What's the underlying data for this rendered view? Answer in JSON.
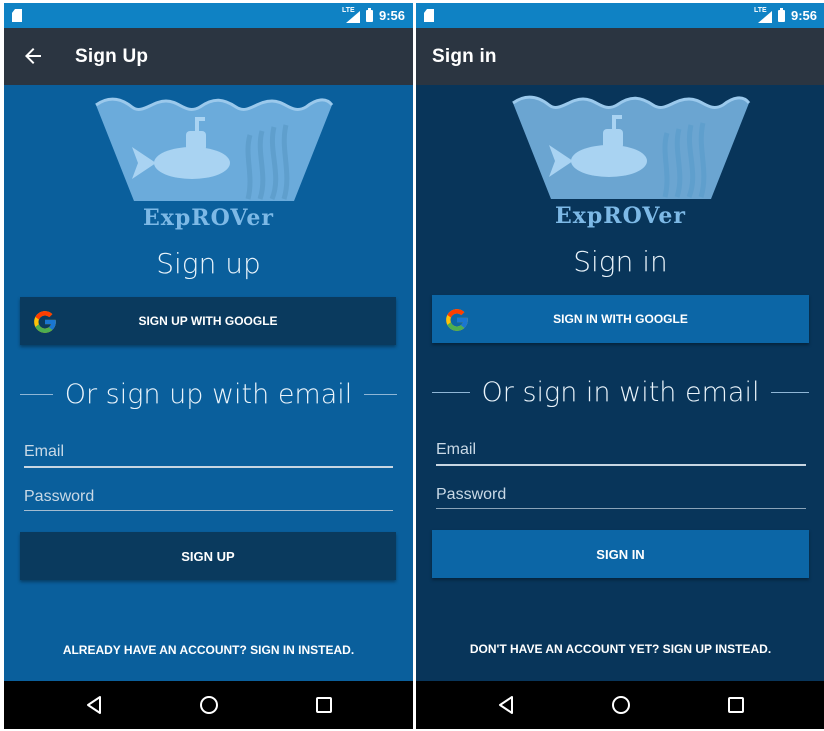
{
  "status_bar": {
    "time": "9:56",
    "network": "LTE"
  },
  "signup": {
    "toolbar_title": "Sign Up",
    "logo_text": "ExpROVer",
    "heading": "Sign up",
    "google_button": "SIGN UP WITH GOOGLE",
    "divider_text": "Or sign up with email",
    "email_placeholder": "Email",
    "password_placeholder": "Password",
    "submit_button": "SIGN UP",
    "switch_link": "ALREADY HAVE AN ACCOUNT? SIGN IN INSTEAD."
  },
  "signin": {
    "toolbar_title": "Sign in",
    "logo_text": "ExpROVer",
    "heading": "Sign in",
    "google_button": "SIGN IN WITH GOOGLE",
    "divider_text": "Or sign in with email",
    "email_placeholder": "Email",
    "password_placeholder": "Password",
    "submit_button": "SIGN IN",
    "switch_link": "DON'T HAVE AN ACCOUNT YET? SIGN UP INSTEAD."
  },
  "icons": {
    "back": "arrow-back-icon",
    "google": "google-g-icon",
    "nav_back": "triangle-back-icon",
    "nav_home": "circle-home-icon",
    "nav_recents": "square-recents-icon"
  },
  "colors": {
    "signup_background": "#0a5f9c",
    "signin_background": "#08355a",
    "status_bar": "#0f82c4",
    "toolbar": "#2b3541",
    "signup_button": "#0a3a5e",
    "signin_button": "#0c66a6",
    "logo": "#7db9e6"
  }
}
